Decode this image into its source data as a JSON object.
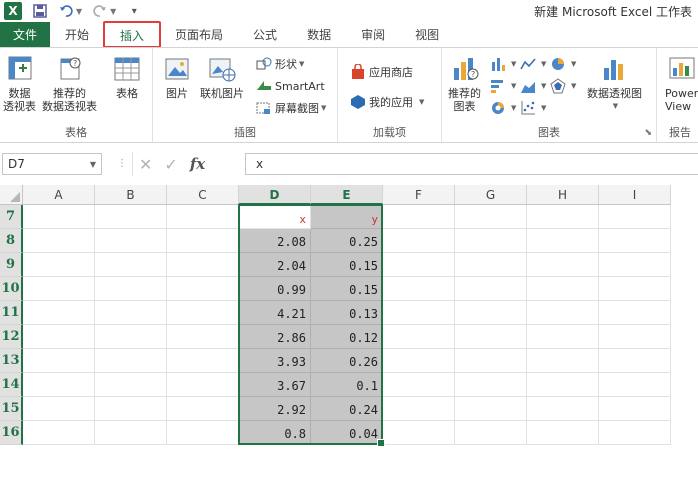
{
  "app": {
    "logo_letter": "X",
    "title": "新建 Microsoft Excel 工作表"
  },
  "tabs": [
    {
      "label": "文件"
    },
    {
      "label": "开始"
    },
    {
      "label": "插入"
    },
    {
      "label": "页面布局"
    },
    {
      "label": "公式"
    },
    {
      "label": "数据"
    },
    {
      "label": "审阅"
    },
    {
      "label": "视图"
    }
  ],
  "ribbon": {
    "groups": {
      "tables": {
        "label": "表格",
        "pivot": "数据\n透视表",
        "rec_pivot": "推荐的\n数据透视表",
        "table": "表格"
      },
      "illustrations": {
        "label": "插图",
        "picture": "图片",
        "online_picture": "联机图片",
        "shapes": "形状",
        "smartart": "SmartArt",
        "screenshot": "屏幕截图"
      },
      "addins": {
        "label": "加载项",
        "store": "应用商店",
        "my_apps": "我的应用"
      },
      "charts": {
        "label": "图表",
        "recommended": "推荐的\n图表",
        "pivot_chart": "数据透视图"
      },
      "reports": {
        "label": "报告",
        "power_view": "Power\nView"
      }
    }
  },
  "formula_bar": {
    "name_box": "D7",
    "fx": "fx",
    "value": "x"
  },
  "columns": [
    "A",
    "B",
    "C",
    "D",
    "E",
    "F",
    "G",
    "H",
    "I"
  ],
  "rows": [
    "7",
    "8",
    "9",
    "10",
    "11",
    "12",
    "13",
    "14",
    "15",
    "16"
  ],
  "cells": {
    "header": {
      "D": "x",
      "E": "y"
    },
    "x": [
      "2.08",
      "2.04",
      "0.99",
      "4.21",
      "2.86",
      "3.93",
      "3.67",
      "2.92",
      "0.8"
    ],
    "y": [
      "0.25",
      "0.15",
      "0.15",
      "0.13",
      "0.12",
      "0.26",
      "0.1",
      "0.24",
      "0.04"
    ]
  },
  "colors": {
    "accent": "#217346",
    "highlight_tab": "#e23b3b",
    "selection_fill": "#c6c6c6",
    "header_text": "#c0392b"
  }
}
